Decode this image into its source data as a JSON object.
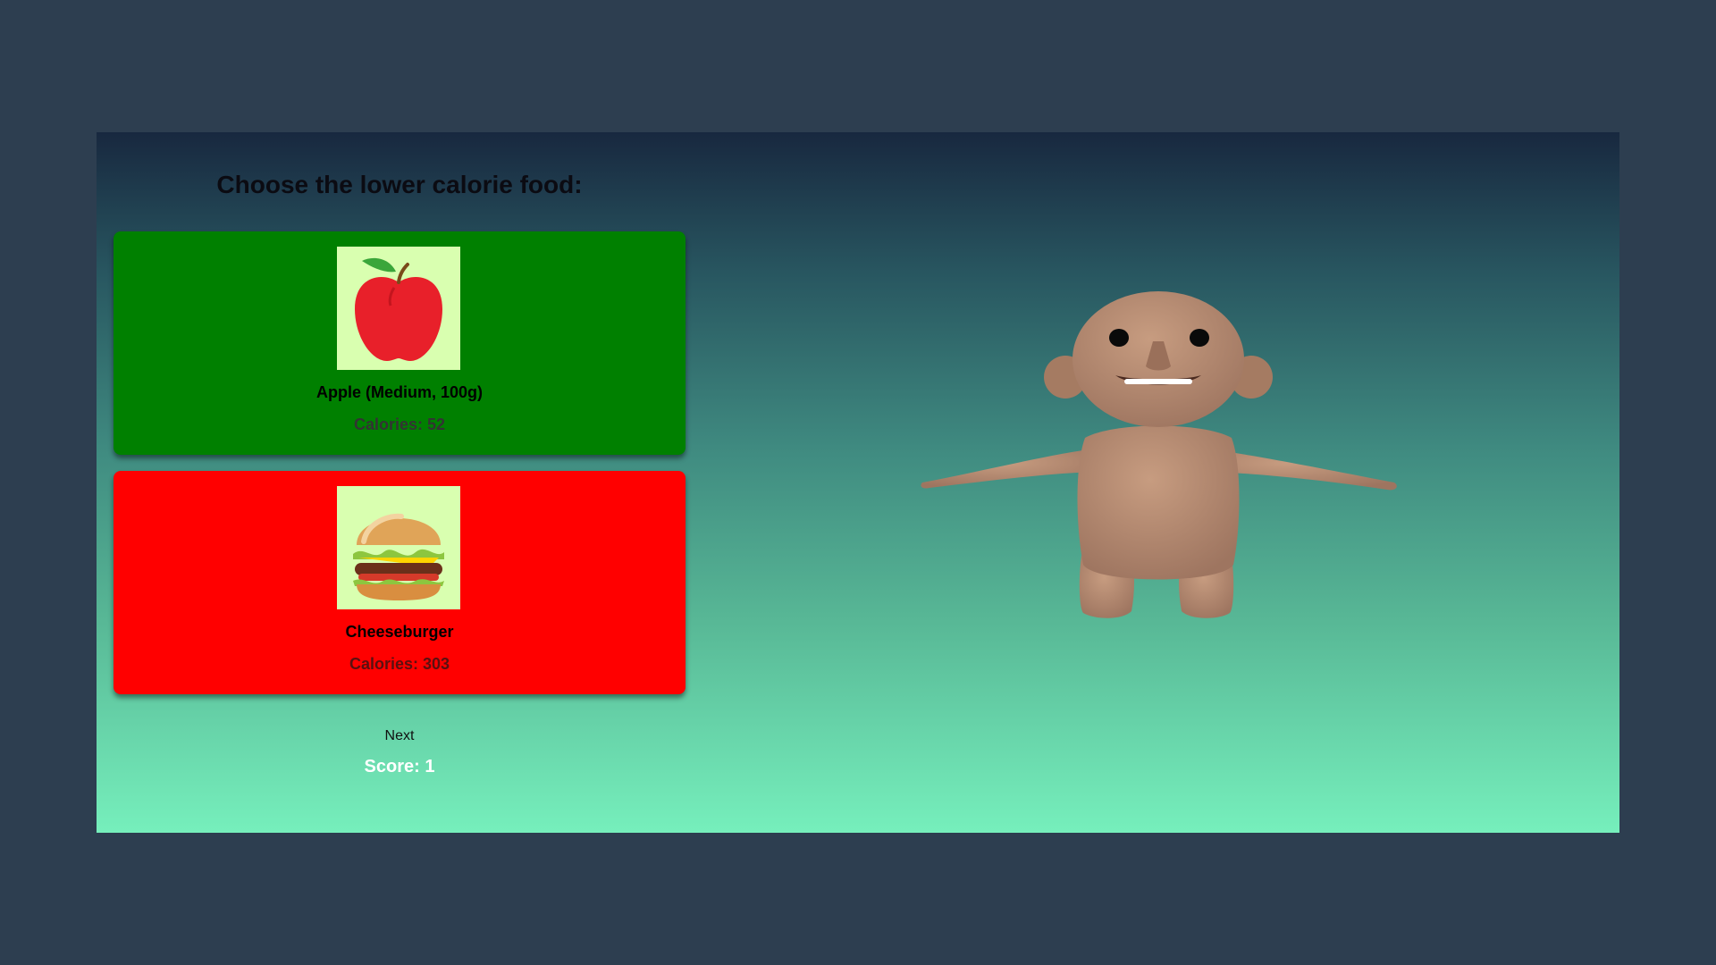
{
  "quiz": {
    "prompt": "Choose the lower calorie food:",
    "options": [
      {
        "name": "Apple (Medium, 100g)",
        "calories_text": "Calories: 52",
        "status": "correct",
        "color": "#008000",
        "icon": "apple-icon"
      },
      {
        "name": "Cheeseburger",
        "calories_text": "Calories: 303",
        "status": "incorrect",
        "color": "#ff0000",
        "icon": "cheeseburger-icon"
      }
    ],
    "next_label": "Next",
    "score_text": "Score: 1"
  },
  "colors": {
    "page_background": "#2d3e50",
    "correct": "#008000",
    "incorrect": "#ff0000",
    "image_background": "#d9ffb0",
    "skin": "#b48a70"
  },
  "scene": {
    "avatar": "3d-character-model"
  }
}
